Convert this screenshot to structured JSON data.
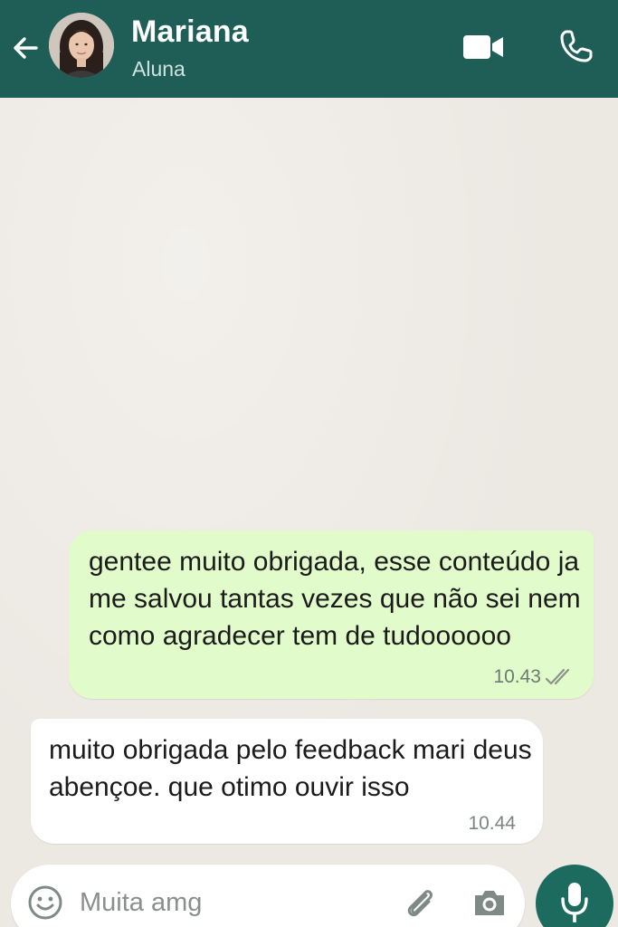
{
  "colors": {
    "header_bg": "#1F5E57",
    "chat_bg": "#ECE8E2",
    "outgoing_bubble": "#E2FBCB",
    "incoming_bubble": "#ffffff",
    "mic_button": "#1C6B5E"
  },
  "header": {
    "contact_name": "Mariana",
    "contact_status": "Aluna",
    "icons": [
      "back-arrow-icon",
      "video-camera-icon",
      "phone-icon"
    ]
  },
  "messages": [
    {
      "direction": "outgoing",
      "text": "gentee muito obrigada, esse conteúdo ja me salvou tantas vezes que não sei nem como agradecer tem de tudoooooo",
      "time": "10.43",
      "status_icon": "double-check-icon"
    },
    {
      "direction": "incoming",
      "text": "muito obrigada pelo feedback mari deus abençoe. que otimo ouvir isso",
      "time": "10.44"
    }
  ],
  "composer": {
    "value": "Muita amg",
    "icons": [
      "emoji-icon",
      "paperclip-icon",
      "camera-icon",
      "microphone-icon"
    ]
  }
}
